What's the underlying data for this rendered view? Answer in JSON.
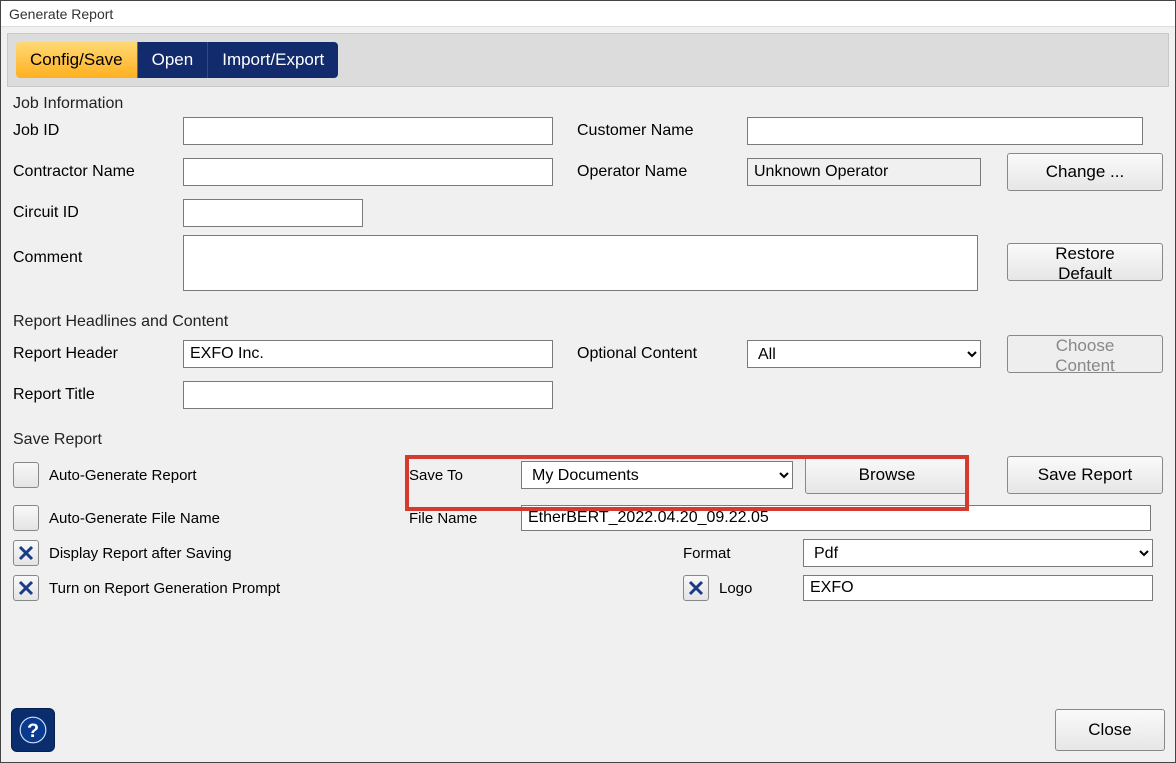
{
  "window": {
    "title": "Generate Report"
  },
  "tabs": {
    "config_save": "Config/Save",
    "open": "Open",
    "import_export": "Import/Export"
  },
  "job_info": {
    "section_title": "Job Information",
    "labels": {
      "job_id": "Job ID",
      "customer_name": "Customer Name",
      "contractor_name": "Contractor Name",
      "operator_name": "Operator Name",
      "circuit_id": "Circuit ID",
      "comment": "Comment"
    },
    "values": {
      "job_id": "",
      "customer_name": "",
      "contractor_name": "",
      "operator_name": "Unknown Operator",
      "circuit_id": "",
      "comment": ""
    },
    "buttons": {
      "change": "Change ...",
      "restore_default": "Restore Default"
    }
  },
  "headlines": {
    "section_title": "Report Headlines and Content",
    "labels": {
      "report_header": "Report Header",
      "optional_content": "Optional Content",
      "report_title": "Report Title"
    },
    "values": {
      "report_header": "EXFO Inc.",
      "optional_content": "All",
      "report_title": ""
    },
    "buttons": {
      "choose_content": "Choose Content"
    }
  },
  "save_report": {
    "section_title": "Save Report",
    "labels": {
      "auto_generate_report": "Auto-Generate Report",
      "auto_generate_filename": "Auto-Generate File Name",
      "display_after_saving": "Display Report after Saving",
      "turn_on_prompt": "Turn on Report Generation Prompt",
      "save_to": "Save To",
      "file_name": "File Name",
      "format": "Format",
      "logo": "Logo"
    },
    "values": {
      "save_to": "My Documents",
      "file_name": "EtherBERT_2022.04.20_09.22.05",
      "format": "Pdf",
      "logo": "EXFO"
    },
    "checks": {
      "auto_generate_report": false,
      "auto_generate_filename": false,
      "display_after_saving": true,
      "turn_on_prompt": true,
      "logo": true
    },
    "buttons": {
      "browse": "Browse",
      "save_report": "Save Report"
    }
  },
  "footer": {
    "close": "Close"
  }
}
